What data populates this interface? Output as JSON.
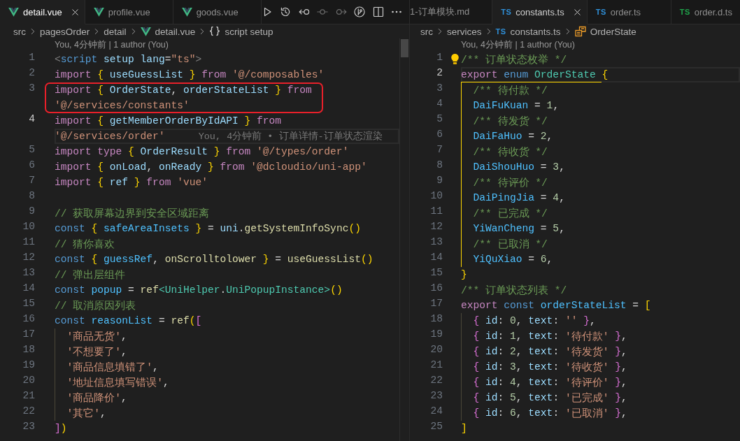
{
  "editor_groups": [
    {
      "focused": true,
      "tabs_scrolled": false,
      "tabs": [
        {
          "label": "detail.vue",
          "selected": true,
          "icon": {
            "kind": "vue"
          }
        },
        {
          "label": "profile.vue",
          "selected": false,
          "icon": {
            "kind": "vue"
          }
        },
        {
          "label": "goods.vue",
          "selected": false,
          "icon": {
            "kind": "vue"
          }
        }
      ],
      "toolbar": [
        {
          "kind": "run",
          "disabled": false
        },
        {
          "kind": "history",
          "disabled": false
        },
        {
          "kind": "previous",
          "disabled": false
        },
        {
          "kind": "commit",
          "disabled": true
        },
        {
          "kind": "next",
          "disabled": true
        },
        {
          "kind": "branch",
          "disabled": false
        },
        {
          "kind": "split",
          "disabled": false
        },
        {
          "kind": "more",
          "disabled": false
        }
      ],
      "breadcrumb": [
        {
          "label": "src"
        },
        {
          "label": "pagesOrder"
        },
        {
          "label": "detail"
        },
        {
          "label": "detail.vue",
          "icon": {
            "kind": "vue"
          }
        },
        {
          "label": "script setup",
          "icon": {
            "kind": "namespace"
          }
        }
      ],
      "codelens": "You, 4分钟前 | 1 author (You)",
      "scrollbar": true,
      "lines": [
        {
          "number": "1",
          "current": false,
          "framed": false,
          "tokens": [
            {
              "kind": "tag",
              "text": "<"
            },
            {
              "kind": "storage",
              "text": "script"
            },
            {
              "kind": "variable",
              "text": " setup lang"
            },
            {
              "kind": "punct",
              "text": "="
            },
            {
              "kind": "string",
              "text": "\"ts\""
            },
            {
              "kind": "tag",
              "text": ">"
            }
          ]
        },
        {
          "number": "2",
          "current": false,
          "framed": false,
          "tokens": [
            {
              "kind": "keyword",
              "text": "import"
            },
            {
              "kind": "bracket1",
              "text": " {"
            },
            {
              "kind": "variable",
              "text": " useGuessList"
            },
            {
              "kind": "bracket1",
              "text": " }"
            },
            {
              "kind": "keyword",
              "text": " from"
            },
            {
              "kind": "string",
              "text": " '@/composables'"
            }
          ]
        },
        {
          "number": "3",
          "current": false,
          "framed": true,
          "tokens": [
            {
              "kind": "keyword",
              "text": "import"
            },
            {
              "kind": "bracket1",
              "text": " {"
            },
            {
              "kind": "variable",
              "text": " OrderState"
            },
            {
              "kind": "punct",
              "text": ","
            },
            {
              "kind": "variable",
              "text": " orderStateList"
            },
            {
              "kind": "bracket1",
              "text": " }"
            },
            {
              "kind": "keyword",
              "text": " from"
            }
          ],
          "wrap": {
            "tokens": [
              {
                "kind": "string",
                "text": "'@/services/constants'"
              }
            ]
          }
        },
        {
          "number": "4",
          "current": true,
          "framed": false,
          "tokens": [
            {
              "kind": "keyword",
              "text": "import"
            },
            {
              "kind": "bracket1",
              "text": " {"
            },
            {
              "kind": "variable",
              "text": " getMemberOrderByIdAPI"
            },
            {
              "kind": "bracket1",
              "text": " }"
            },
            {
              "kind": "keyword",
              "text": " from"
            }
          ],
          "wrap": {
            "tokens": [
              {
                "kind": "string",
                "text": "'@/services/order'"
              }
            ],
            "blame": "You, 4分钟前 • 订单详情-订单状态渲染"
          }
        },
        {
          "number": "5",
          "current": false,
          "framed": false,
          "tokens": [
            {
              "kind": "keyword",
              "text": "import"
            },
            {
              "kind": "keyword",
              "text": " type"
            },
            {
              "kind": "bracket1",
              "text": " {"
            },
            {
              "kind": "variable",
              "text": " OrderResult"
            },
            {
              "kind": "bracket1",
              "text": " }"
            },
            {
              "kind": "keyword",
              "text": " from"
            },
            {
              "kind": "string",
              "text": " '@/types/order'"
            }
          ]
        },
        {
          "number": "6",
          "current": false,
          "framed": false,
          "tokens": [
            {
              "kind": "keyword",
              "text": "import"
            },
            {
              "kind": "bracket1",
              "text": " {"
            },
            {
              "kind": "variable",
              "text": " onLoad"
            },
            {
              "kind": "punct",
              "text": ","
            },
            {
              "kind": "variable",
              "text": " onReady"
            },
            {
              "kind": "bracket1",
              "text": " }"
            },
            {
              "kind": "keyword",
              "text": " from"
            },
            {
              "kind": "string",
              "text": " '@dcloudio/uni-app'"
            }
          ]
        },
        {
          "number": "7",
          "current": false,
          "framed": false,
          "tokens": [
            {
              "kind": "keyword",
              "text": "import"
            },
            {
              "kind": "bracket1",
              "text": " {"
            },
            {
              "kind": "variable",
              "text": " ref"
            },
            {
              "kind": "bracket1",
              "text": " }"
            },
            {
              "kind": "keyword",
              "text": " from"
            },
            {
              "kind": "string",
              "text": " 'vue'"
            }
          ]
        },
        {
          "number": "8",
          "current": false,
          "framed": false
        },
        {
          "number": "9",
          "current": false,
          "framed": false,
          "tokens": [
            {
              "kind": "comment",
              "text": "// 获取屏幕边界到安全区域距离"
            }
          ]
        },
        {
          "number": "10",
          "current": false,
          "framed": false,
          "tokens": [
            {
              "kind": "storage",
              "text": "const"
            },
            {
              "kind": "bracket1",
              "text": " {"
            },
            {
              "kind": "constant",
              "text": " safeAreaInsets"
            },
            {
              "kind": "bracket1",
              "text": " }"
            },
            {
              "kind": "punct",
              "text": " ="
            },
            {
              "kind": "variable",
              "text": " uni"
            },
            {
              "kind": "punct",
              "text": "."
            },
            {
              "kind": "function",
              "text": "getSystemInfoSync"
            },
            {
              "kind": "bracket1",
              "text": "()"
            }
          ]
        },
        {
          "number": "11",
          "current": false,
          "framed": false,
          "tokens": [
            {
              "kind": "comment",
              "text": "// 猜你喜欢"
            }
          ]
        },
        {
          "number": "12",
          "current": false,
          "framed": false,
          "tokens": [
            {
              "kind": "storage",
              "text": "const"
            },
            {
              "kind": "bracket1",
              "text": " {"
            },
            {
              "kind": "constant",
              "text": " guessRef"
            },
            {
              "kind": "punct",
              "text": ","
            },
            {
              "kind": "function",
              "text": " onScrolltolower"
            },
            {
              "kind": "bracket1",
              "text": " }"
            },
            {
              "kind": "punct",
              "text": " ="
            },
            {
              "kind": "function",
              "text": " useGuessList"
            },
            {
              "kind": "bracket1",
              "text": "()"
            }
          ]
        },
        {
          "number": "13",
          "current": false,
          "framed": false,
          "tokens": [
            {
              "kind": "comment",
              "text": "// 弹出层组件"
            }
          ]
        },
        {
          "number": "14",
          "current": false,
          "framed": false,
          "tokens": [
            {
              "kind": "storage",
              "text": "const"
            },
            {
              "kind": "constant",
              "text": " popup"
            },
            {
              "kind": "punct",
              "text": " ="
            },
            {
              "kind": "function",
              "text": " ref"
            },
            {
              "kind": "type",
              "text": "<UniHelper"
            },
            {
              "kind": "punct",
              "text": "."
            },
            {
              "kind": "type",
              "text": "UniPopupInstance>"
            },
            {
              "kind": "bracket1",
              "text": "()"
            }
          ]
        },
        {
          "number": "15",
          "current": false,
          "framed": false,
          "tokens": [
            {
              "kind": "comment",
              "text": "// 取消原因列表"
            }
          ]
        },
        {
          "number": "16",
          "current": false,
          "framed": false,
          "tokens": [
            {
              "kind": "storage",
              "text": "const"
            },
            {
              "kind": "constant",
              "text": " reasonList"
            },
            {
              "kind": "punct",
              "text": " ="
            },
            {
              "kind": "function",
              "text": " ref"
            },
            {
              "kind": "bracket1",
              "text": "("
            },
            {
              "kind": "bracket2",
              "text": "["
            }
          ],
          "children": [
            {
              "number": "17",
              "current": false,
              "framed": false,
              "tokens": [
                {
                  "kind": "string",
                  "text": "'商品无货'"
                },
                {
                  "kind": "punct",
                  "text": ","
                }
              ]
            },
            {
              "number": "18",
              "current": false,
              "framed": false,
              "tokens": [
                {
                  "kind": "string",
                  "text": "'不想要了'"
                },
                {
                  "kind": "punct",
                  "text": ","
                }
              ]
            },
            {
              "number": "19",
              "current": false,
              "framed": false,
              "tokens": [
                {
                  "kind": "string",
                  "text": "'商品信息填错了'"
                },
                {
                  "kind": "punct",
                  "text": ","
                }
              ]
            },
            {
              "number": "20",
              "current": false,
              "framed": false,
              "tokens": [
                {
                  "kind": "string",
                  "text": "'地址信息填写错误'"
                },
                {
                  "kind": "punct",
                  "text": ","
                }
              ]
            },
            {
              "number": "21",
              "current": false,
              "framed": false,
              "tokens": [
                {
                  "kind": "string",
                  "text": "'商品降价'"
                },
                {
                  "kind": "punct",
                  "text": ","
                }
              ]
            },
            {
              "number": "22",
              "current": false,
              "framed": false,
              "tokens": [
                {
                  "kind": "string",
                  "text": "'其它'"
                },
                {
                  "kind": "punct",
                  "text": ","
                }
              ]
            }
          ]
        },
        {
          "number": "23",
          "current": false,
          "framed": false,
          "tokens": [
            {
              "kind": "bracket2",
              "text": "]"
            },
            {
              "kind": "bracket1",
              "text": ")"
            }
          ]
        }
      ]
    },
    {
      "focused": false,
      "tabs_scrolled": true,
      "tabs": [
        {
          "label": "1-订单模块.md",
          "selected": false
        },
        {
          "label": "constants.ts",
          "selected": true,
          "icon": {
            "kind": "ts",
            "text": "TS",
            "color": "#2f8fd8"
          }
        },
        {
          "label": "order.ts",
          "selected": false,
          "icon": {
            "kind": "ts",
            "text": "TS",
            "color": "#2f8fd8"
          }
        },
        {
          "label": "order.d.ts",
          "selected": false,
          "icon": {
            "kind": "ts",
            "text": "TS",
            "color": "#1fa24a"
          }
        }
      ],
      "breadcrumb": [
        {
          "label": "src"
        },
        {
          "label": "services"
        },
        {
          "label": "constants.ts",
          "icon": {
            "kind": "ts",
            "text": "TS",
            "color": "#2f8fd8"
          }
        },
        {
          "label": "OrderState",
          "icon": {
            "kind": "enum"
          }
        }
      ],
      "codelens": "You, 4分钟前 | 1 author (You)",
      "lightbulb": true,
      "lines": [
        {
          "number": "1",
          "current": false,
          "tokens": [
            {
              "kind": "comment",
              "text": "/** 订单状态枚举 */"
            }
          ]
        },
        {
          "number": "2",
          "current": true,
          "tokens": [
            {
              "kind": "keyword",
              "text": "export"
            },
            {
              "kind": "storage",
              "text": " enum"
            },
            {
              "kind": "type",
              "text": " OrderState "
            },
            {
              "kind": "bracket1",
              "text": "{"
            }
          ],
          "children": [
            {
              "number": "3",
              "current": false,
              "tokens": [
                {
                  "kind": "comment",
                  "text": "/** 待付款 */"
                }
              ]
            },
            {
              "number": "4",
              "current": false,
              "tokens": [
                {
                  "kind": "constant",
                  "text": "DaiFuKuan"
                },
                {
                  "kind": "punct",
                  "text": " = "
                },
                {
                  "kind": "number",
                  "text": "1"
                },
                {
                  "kind": "punct",
                  "text": ","
                }
              ]
            },
            {
              "number": "5",
              "current": false,
              "tokens": [
                {
                  "kind": "comment",
                  "text": "/** 待发货 */"
                }
              ]
            },
            {
              "number": "6",
              "current": false,
              "tokens": [
                {
                  "kind": "constant",
                  "text": "DaiFaHuo"
                },
                {
                  "kind": "punct",
                  "text": " = "
                },
                {
                  "kind": "number",
                  "text": "2"
                },
                {
                  "kind": "punct",
                  "text": ","
                }
              ]
            },
            {
              "number": "7",
              "current": false,
              "tokens": [
                {
                  "kind": "comment",
                  "text": "/** 待收货 */"
                }
              ]
            },
            {
              "number": "8",
              "current": false,
              "tokens": [
                {
                  "kind": "constant",
                  "text": "DaiShouHuo"
                },
                {
                  "kind": "punct",
                  "text": " = "
                },
                {
                  "kind": "number",
                  "text": "3"
                },
                {
                  "kind": "punct",
                  "text": ","
                }
              ]
            },
            {
              "number": "9",
              "current": false,
              "tokens": [
                {
                  "kind": "comment",
                  "text": "/** 待评价 */"
                }
              ]
            },
            {
              "number": "10",
              "current": false,
              "tokens": [
                {
                  "kind": "constant",
                  "text": "DaiPingJia"
                },
                {
                  "kind": "punct",
                  "text": " = "
                },
                {
                  "kind": "number",
                  "text": "4"
                },
                {
                  "kind": "punct",
                  "text": ","
                }
              ]
            },
            {
              "number": "11",
              "current": false,
              "tokens": [
                {
                  "kind": "comment",
                  "text": "/** 已完成 */"
                }
              ]
            },
            {
              "number": "12",
              "current": false,
              "tokens": [
                {
                  "kind": "constant",
                  "text": "YiWanCheng"
                },
                {
                  "kind": "punct",
                  "text": " = "
                },
                {
                  "kind": "number",
                  "text": "5"
                },
                {
                  "kind": "punct",
                  "text": ","
                }
              ]
            },
            {
              "number": "13",
              "current": false,
              "tokens": [
                {
                  "kind": "comment",
                  "text": "/** 已取消 */"
                }
              ]
            },
            {
              "number": "14",
              "current": false,
              "tokens": [
                {
                  "kind": "constant",
                  "text": "YiQuXiao"
                },
                {
                  "kind": "punct",
                  "text": " = "
                },
                {
                  "kind": "number",
                  "text": "6"
                },
                {
                  "kind": "punct",
                  "text": ","
                }
              ]
            }
          ]
        },
        {
          "number": "15",
          "current": false,
          "tokens": [
            {
              "kind": "bracket1",
              "text": "}"
            }
          ]
        },
        {
          "number": "16",
          "current": false,
          "tokens": [
            {
              "kind": "comment",
              "text": "/** 订单状态列表 */"
            }
          ]
        },
        {
          "number": "17",
          "current": false,
          "tokens": [
            {
              "kind": "keyword",
              "text": "export"
            },
            {
              "kind": "storage",
              "text": " const"
            },
            {
              "kind": "constant",
              "text": " orderStateList"
            },
            {
              "kind": "punct",
              "text": " ="
            },
            {
              "kind": "bracket1",
              "text": " ["
            }
          ],
          "children": [
            {
              "number": "18",
              "current": false,
              "tokens": [
                {
                  "kind": "bracket2",
                  "text": "{"
                },
                {
                  "kind": "variable",
                  "text": " id"
                },
                {
                  "kind": "punct",
                  "text": ": "
                },
                {
                  "kind": "number",
                  "text": "0"
                },
                {
                  "kind": "punct",
                  "text": ", "
                },
                {
                  "kind": "variable",
                  "text": "text"
                },
                {
                  "kind": "punct",
                  "text": ": "
                },
                {
                  "kind": "string",
                  "text": "''"
                },
                {
                  "kind": "bracket2",
                  "text": " }"
                },
                {
                  "kind": "punct",
                  "text": ","
                }
              ]
            },
            {
              "number": "19",
              "current": false,
              "tokens": [
                {
                  "kind": "bracket2",
                  "text": "{"
                },
                {
                  "kind": "variable",
                  "text": " id"
                },
                {
                  "kind": "punct",
                  "text": ": "
                },
                {
                  "kind": "number",
                  "text": "1"
                },
                {
                  "kind": "punct",
                  "text": ", "
                },
                {
                  "kind": "variable",
                  "text": "text"
                },
                {
                  "kind": "punct",
                  "text": ": "
                },
                {
                  "kind": "string",
                  "text": "'待付款'"
                },
                {
                  "kind": "bracket2",
                  "text": " }"
                },
                {
                  "kind": "punct",
                  "text": ","
                }
              ]
            },
            {
              "number": "20",
              "current": false,
              "tokens": [
                {
                  "kind": "bracket2",
                  "text": "{"
                },
                {
                  "kind": "variable",
                  "text": " id"
                },
                {
                  "kind": "punct",
                  "text": ": "
                },
                {
                  "kind": "number",
                  "text": "2"
                },
                {
                  "kind": "punct",
                  "text": ", "
                },
                {
                  "kind": "variable",
                  "text": "text"
                },
                {
                  "kind": "punct",
                  "text": ": "
                },
                {
                  "kind": "string",
                  "text": "'待发货'"
                },
                {
                  "kind": "bracket2",
                  "text": " }"
                },
                {
                  "kind": "punct",
                  "text": ","
                }
              ]
            },
            {
              "number": "21",
              "current": false,
              "tokens": [
                {
                  "kind": "bracket2",
                  "text": "{"
                },
                {
                  "kind": "variable",
                  "text": " id"
                },
                {
                  "kind": "punct",
                  "text": ": "
                },
                {
                  "kind": "number",
                  "text": "3"
                },
                {
                  "kind": "punct",
                  "text": ", "
                },
                {
                  "kind": "variable",
                  "text": "text"
                },
                {
                  "kind": "punct",
                  "text": ": "
                },
                {
                  "kind": "string",
                  "text": "'待收货'"
                },
                {
                  "kind": "bracket2",
                  "text": " }"
                },
                {
                  "kind": "punct",
                  "text": ","
                }
              ]
            },
            {
              "number": "22",
              "current": false,
              "tokens": [
                {
                  "kind": "bracket2",
                  "text": "{"
                },
                {
                  "kind": "variable",
                  "text": " id"
                },
                {
                  "kind": "punct",
                  "text": ": "
                },
                {
                  "kind": "number",
                  "text": "4"
                },
                {
                  "kind": "punct",
                  "text": ", "
                },
                {
                  "kind": "variable",
                  "text": "text"
                },
                {
                  "kind": "punct",
                  "text": ": "
                },
                {
                  "kind": "string",
                  "text": "'待评价'"
                },
                {
                  "kind": "bracket2",
                  "text": " }"
                },
                {
                  "kind": "punct",
                  "text": ","
                }
              ]
            },
            {
              "number": "23",
              "current": false,
              "tokens": [
                {
                  "kind": "bracket2",
                  "text": "{"
                },
                {
                  "kind": "variable",
                  "text": " id"
                },
                {
                  "kind": "punct",
                  "text": ": "
                },
                {
                  "kind": "number",
                  "text": "5"
                },
                {
                  "kind": "punct",
                  "text": ", "
                },
                {
                  "kind": "variable",
                  "text": "text"
                },
                {
                  "kind": "punct",
                  "text": ": "
                },
                {
                  "kind": "string",
                  "text": "'已完成'"
                },
                {
                  "kind": "bracket2",
                  "text": " }"
                },
                {
                  "kind": "punct",
                  "text": ","
                }
              ]
            },
            {
              "number": "24",
              "current": false,
              "tokens": [
                {
                  "kind": "bracket2",
                  "text": "{"
                },
                {
                  "kind": "variable",
                  "text": " id"
                },
                {
                  "kind": "punct",
                  "text": ": "
                },
                {
                  "kind": "number",
                  "text": "6"
                },
                {
                  "kind": "punct",
                  "text": ", "
                },
                {
                  "kind": "variable",
                  "text": "text"
                },
                {
                  "kind": "punct",
                  "text": ": "
                },
                {
                  "kind": "string",
                  "text": "'已取消'"
                },
                {
                  "kind": "bracket2",
                  "text": " }"
                },
                {
                  "kind": "punct",
                  "text": ","
                }
              ]
            }
          ]
        },
        {
          "number": "25",
          "current": false,
          "tokens": [
            {
              "kind": "bracket1",
              "text": "]"
            }
          ]
        }
      ]
    }
  ]
}
